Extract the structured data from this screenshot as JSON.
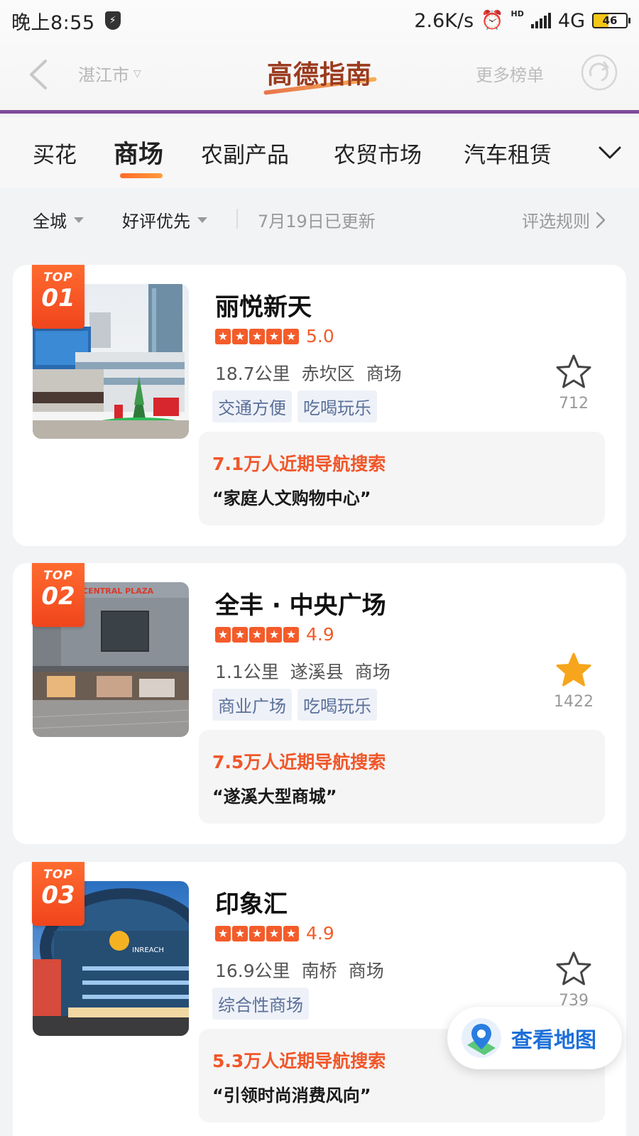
{
  "status_bar": {
    "time": "晚上8:55",
    "net_speed": "2.6K/s",
    "network": "4G",
    "battery": "46",
    "hd_label": "HD"
  },
  "header": {
    "city": "湛江市",
    "logo": "高德指南",
    "more": "更多榜单"
  },
  "tabs": [
    {
      "label": "买花",
      "active": false
    },
    {
      "label": "商场",
      "active": true
    },
    {
      "label": "农副产品",
      "active": false
    },
    {
      "label": "农贸市场",
      "active": false
    },
    {
      "label": "汽车租赁",
      "active": false
    }
  ],
  "filters": {
    "area": "全城",
    "sort": "好评优先",
    "updated": "7月19日已更新",
    "rules": "评选规则"
  },
  "cards": [
    {
      "rank_label": "TOP",
      "rank": "01",
      "name": "丽悦新天",
      "rating": "5.0",
      "distance": "18.7公里",
      "district": "赤坎区",
      "category": "商场",
      "tags": [
        "交通方便",
        "吃喝玩乐"
      ],
      "favorited": false,
      "fav_count": "712",
      "search_heat": "7.1万人近期导航搜索",
      "quote": "“家庭人文购物中心”"
    },
    {
      "rank_label": "TOP",
      "rank": "02",
      "name": "全丰 · 中央广场",
      "rating": "4.9",
      "distance": "1.1公里",
      "district": "遂溪县",
      "category": "商场",
      "tags": [
        "商业广场",
        "吃喝玩乐"
      ],
      "favorited": true,
      "fav_count": "1422",
      "search_heat": "7.5万人近期导航搜索",
      "quote": "“遂溪大型商城”",
      "photo_sign": "CENTRAL PLAZA"
    },
    {
      "rank_label": "TOP",
      "rank": "03",
      "name": "印象汇",
      "rating": "4.9",
      "distance": "16.9公里",
      "district": "南桥",
      "category": "商场",
      "tags": [
        "综合性商场"
      ],
      "favorited": false,
      "fav_count": "739",
      "search_heat": "5.3万人近期导航搜索",
      "quote": "“引领时尚消费风向”",
      "photo_sign": "INREACH"
    }
  ],
  "map_button": {
    "label": "查看地图"
  },
  "colors": {
    "accent": "#f35c2a",
    "favorite": "#f7a51c",
    "map_blue": "#1c6fd8",
    "header_line": "#7d4a9a"
  },
  "icons": [
    "back-arrow-icon",
    "chevron-down-icon",
    "refresh-icon",
    "star-outline-icon",
    "star-filled-icon",
    "map-pin-icon",
    "chevron-right-icon"
  ]
}
